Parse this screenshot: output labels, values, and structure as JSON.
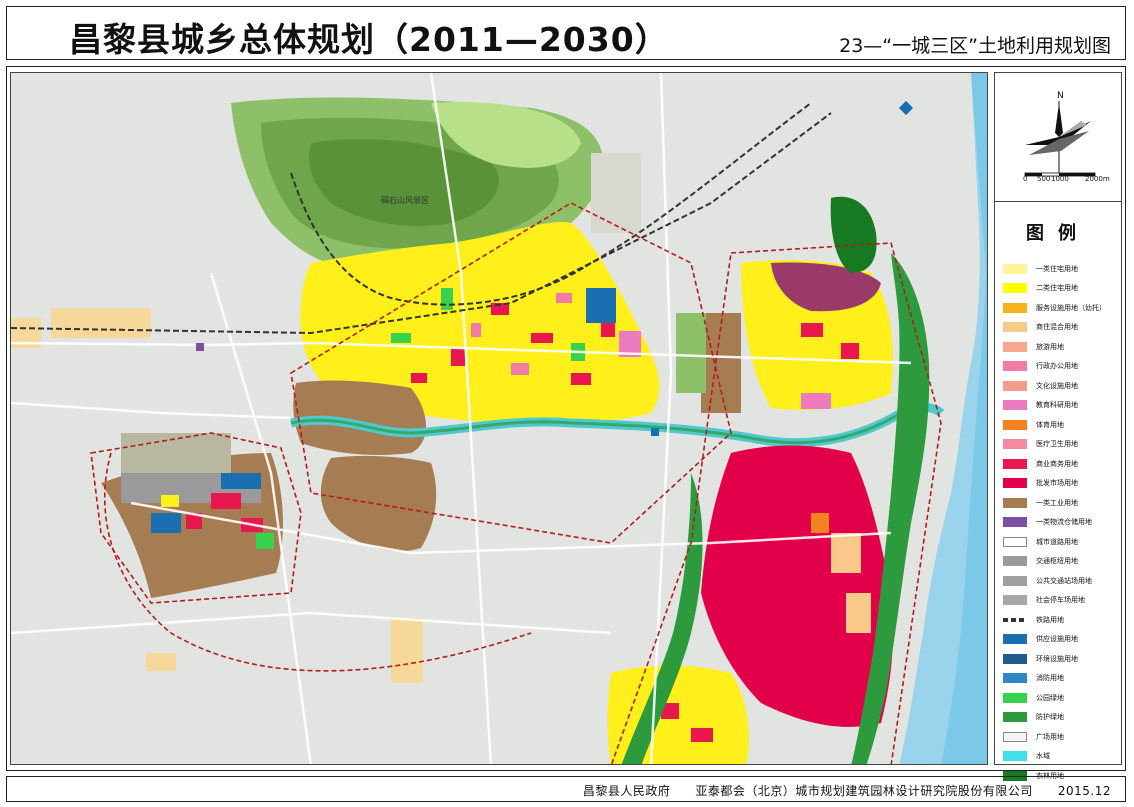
{
  "header": {
    "title": "昌黎县城乡总体规划（2011—2030）",
    "subtitle": "23—“一城三区”土地利用规划图"
  },
  "map": {
    "labels": {
      "scenic": "碣石山风景区"
    },
    "north": "N",
    "scale_ticks": [
      "0",
      "500",
      "1000",
      "2000m"
    ]
  },
  "legend": {
    "title": "图例",
    "items": [
      {
        "label": "一类住宅用地",
        "color": "#fdf49a"
      },
      {
        "label": "二类住宅用地",
        "color": "#ffff00"
      },
      {
        "label": "服务设施用地（幼托）",
        "color": "#f7b21a"
      },
      {
        "label": "商住混合用地",
        "color": "#f9c98a"
      },
      {
        "label": "旅游用地",
        "color": "#f6a78d"
      },
      {
        "label": "行政办公用地",
        "color": "#f27aa6"
      },
      {
        "label": "文化设施用地",
        "color": "#f59c8a"
      },
      {
        "label": "教育科研用地",
        "color": "#ec7ac0"
      },
      {
        "label": "体育用地",
        "color": "#f58220"
      },
      {
        "label": "医疗卫生用地",
        "color": "#f28aa0"
      },
      {
        "label": "商业商务用地",
        "color": "#e8174f"
      },
      {
        "label": "批发市场用地",
        "color": "#e2004a"
      },
      {
        "label": "一类工业用地",
        "color": "#a67c52"
      },
      {
        "label": "一类物流仓储用地",
        "color": "#7d4fa0"
      },
      {
        "label": "城市道路用地",
        "color": "#ffffff"
      },
      {
        "label": "交通枢纽用地",
        "color": "#9a9a9a"
      },
      {
        "label": "公共交通站场用地",
        "color": "#a0a0a0"
      },
      {
        "label": "社会停车场用地",
        "color": "#a8a8a8"
      },
      {
        "label": "铁路用地",
        "color": "#333333"
      },
      {
        "label": "供应设施用地",
        "color": "#1a6fb0"
      },
      {
        "label": "环境设施用地",
        "color": "#1f5c8c"
      },
      {
        "label": "消防用地",
        "color": "#2f86c6"
      },
      {
        "label": "公园绿地",
        "color": "#38d24c"
      },
      {
        "label": "防护绿地",
        "color": "#2e9a3e"
      },
      {
        "label": "广场用地",
        "color": "#f4f4f4"
      },
      {
        "label": "水域",
        "color": "#3fe0ea"
      },
      {
        "label": "农林用地",
        "color": "#157a22"
      }
    ]
  },
  "footer": {
    "text": "昌黎县人民政府　　亚泰都会（北京）城市规划建筑园林设计研究院股份有限公司　　2015.12"
  }
}
